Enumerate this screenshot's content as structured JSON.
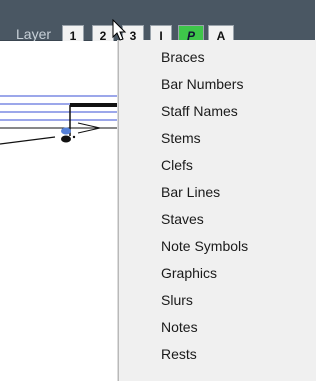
{
  "toolbar": {
    "layer_label": "Layer",
    "buttons": [
      {
        "label": "1"
      },
      {
        "label": "2"
      },
      {
        "label": "3"
      },
      {
        "label": "I"
      },
      {
        "label": "P"
      },
      {
        "label": "A"
      }
    ],
    "active_color": "#3ec64a"
  },
  "menu": {
    "items": [
      {
        "label": "Braces"
      },
      {
        "label": "Bar Numbers"
      },
      {
        "label": "Staff Names"
      },
      {
        "label": "Stems"
      },
      {
        "label": "Clefs"
      },
      {
        "label": "Bar Lines"
      },
      {
        "label": "Staves"
      },
      {
        "label": "Note Symbols"
      },
      {
        "label": "Graphics"
      },
      {
        "label": "Slurs"
      },
      {
        "label": "Notes"
      },
      {
        "label": "Rests"
      }
    ]
  }
}
